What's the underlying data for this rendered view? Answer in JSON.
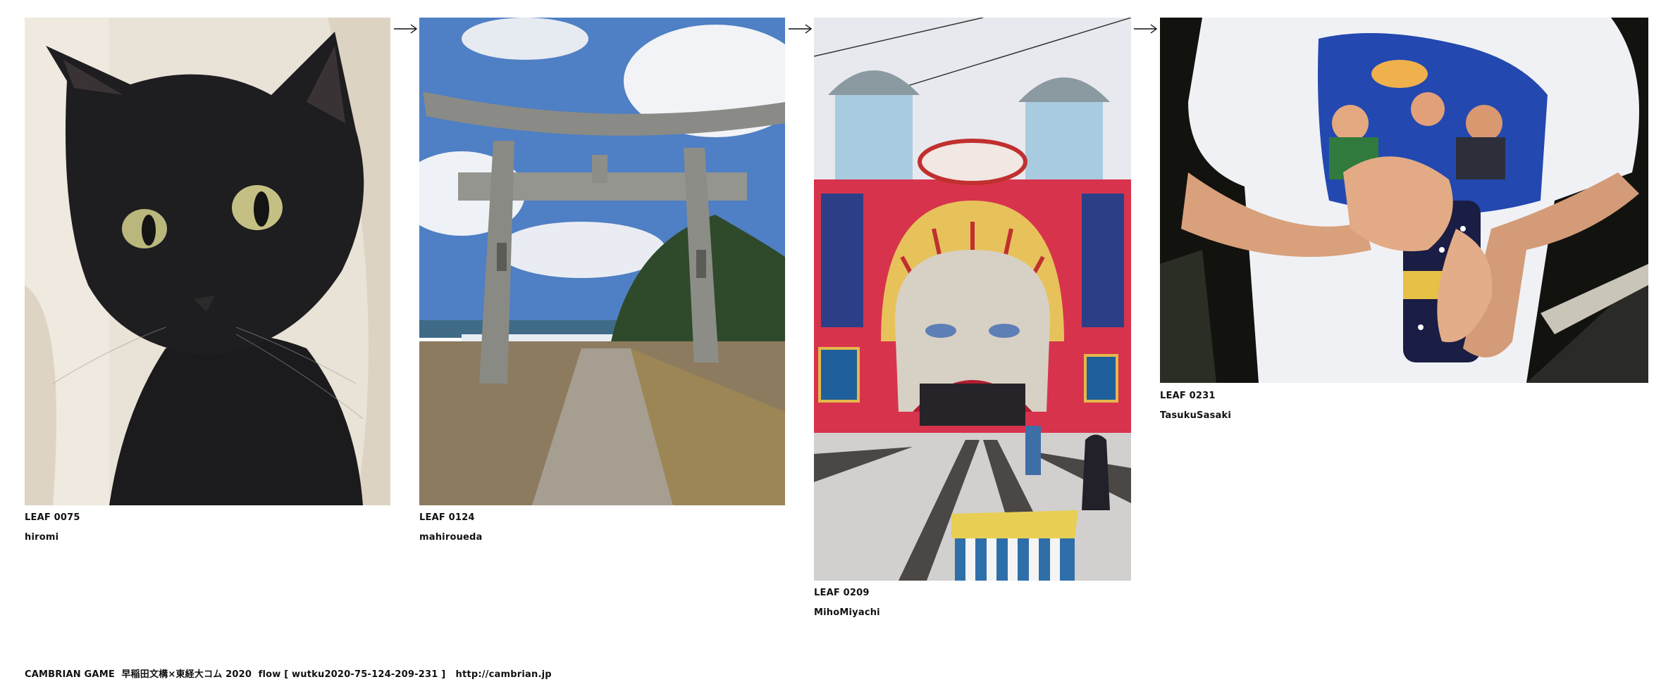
{
  "flow": {
    "leaves": [
      {
        "id": "LEAF 0075",
        "author": "hiromi",
        "subject": "black cat"
      },
      {
        "id": "LEAF 0124",
        "author": "mahiroueda",
        "subject": "torii gate by the sea"
      },
      {
        "id": "LEAF 0209",
        "author": "MihoMiyachi",
        "subject": "Luna Park entrance"
      },
      {
        "id": "LEAF 0231",
        "author": "TasukuSasaki",
        "subject": "hands holding a can over a printed t-shirt"
      }
    ],
    "arrow_glyph": "→"
  },
  "footer": {
    "text": "CAMBRIAN GAME  早稲田文構×東経大コム 2020  flow [ wutku2020-75-124-209-231 ]   http://cambrian.jp"
  },
  "colors": {
    "background": "#ffffff",
    "text": "#111111"
  }
}
